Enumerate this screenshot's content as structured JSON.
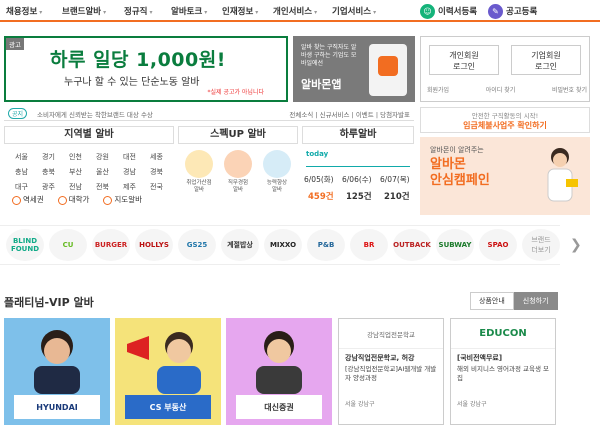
{
  "nav": {
    "items": [
      "채용정보",
      "브랜드알바",
      "정규직",
      "알바토크",
      "인재정보",
      "개인서비스",
      "기업서비스"
    ],
    "resume_button": "이력서등록",
    "post_button": "공고등록",
    "accent": "#f26d21"
  },
  "banner": {
    "ad_label": "광고",
    "headline": "하루 일당 1,000원!",
    "subline": "누구나 할 수 있는 단순노동 알바",
    "disclaimer": "*실제 공고가 아닙니다",
    "color": "#0a7d3e"
  },
  "app_banner": {
    "small": "알바 찾는 구직자도 알바생 구하는 기업도 모바일에선",
    "big": "알바몬앱"
  },
  "login": {
    "personal": "개인회원\n로그인",
    "company": "기업회원\n로그인",
    "links": [
      "회원가입",
      "아이디 찾기",
      "비밀번호 찾기"
    ]
  },
  "notice": {
    "tag": "공지",
    "text": "소비자에게 신뢰받는 착한브랜드 대상 수상",
    "links": "전체소식 | 신규서비스 | 이벤트 | 당첨자발표"
  },
  "columns": {
    "regions_title": "지역별 알바",
    "spec_title": "스펙UP 알바",
    "daily_title": "하루알바"
  },
  "regions": {
    "cells": [
      "서울",
      "경기",
      "인천",
      "강원",
      "대전",
      "세종",
      "충남",
      "충북",
      "부산",
      "울산",
      "경남",
      "경북",
      "대구",
      "광주",
      "전남",
      "전북",
      "제주",
      "전국"
    ],
    "bottom": [
      "역세권",
      "대학가",
      "지도알바"
    ]
  },
  "spec": {
    "cards": [
      "취업가산점\n알바",
      "직무경험\n알바",
      "능력향상\n알바"
    ]
  },
  "daily": {
    "today_label": "today",
    "dates": [
      "6/05(화)",
      "6/06(수)",
      "6/07(목)"
    ],
    "counts": [
      "459건",
      "125건",
      "210건"
    ]
  },
  "promo1": {
    "small": "안전한 구직활동의 시작!",
    "big": "임금체불사업주 확인하기"
  },
  "promo2": {
    "small": "알바몬이 알려주는",
    "big1": "알바몬",
    "big2": "안심캠페인"
  },
  "brands": [
    "BLIND FOUND",
    "CU",
    "BURGER",
    "HOLLYS",
    "GS25",
    "계절밥상",
    "MIXXO",
    "P&B",
    "BR",
    "OUTBACK",
    "SUBWAY",
    "SPAO",
    "브랜드\n더보기"
  ],
  "platinum": {
    "title": "플래티넘-VIP 알바",
    "tabs": [
      "상품안내",
      "신청하기"
    ],
    "cards": [
      {
        "logo": "HYUNDAI",
        "bg": "#7ec0ea"
      },
      {
        "logo": "CS 부동산",
        "bg": "#f5e37a"
      },
      {
        "logo": "대신증권",
        "bg": "#e6a7ef"
      }
    ],
    "text_cards": [
      {
        "header": "강남직업전문학교",
        "title": "강남직업전문학교, 허강",
        "desc": "[강남직업전문학교]AI웹개발 개발자 양성과정",
        "loc": "서울 강남구"
      },
      {
        "header": "EDUCON",
        "title": "[국비전액무료]",
        "desc": "해외 비지니스 영어과정 교육생 모집",
        "loc": "서울 강남구"
      }
    ]
  }
}
